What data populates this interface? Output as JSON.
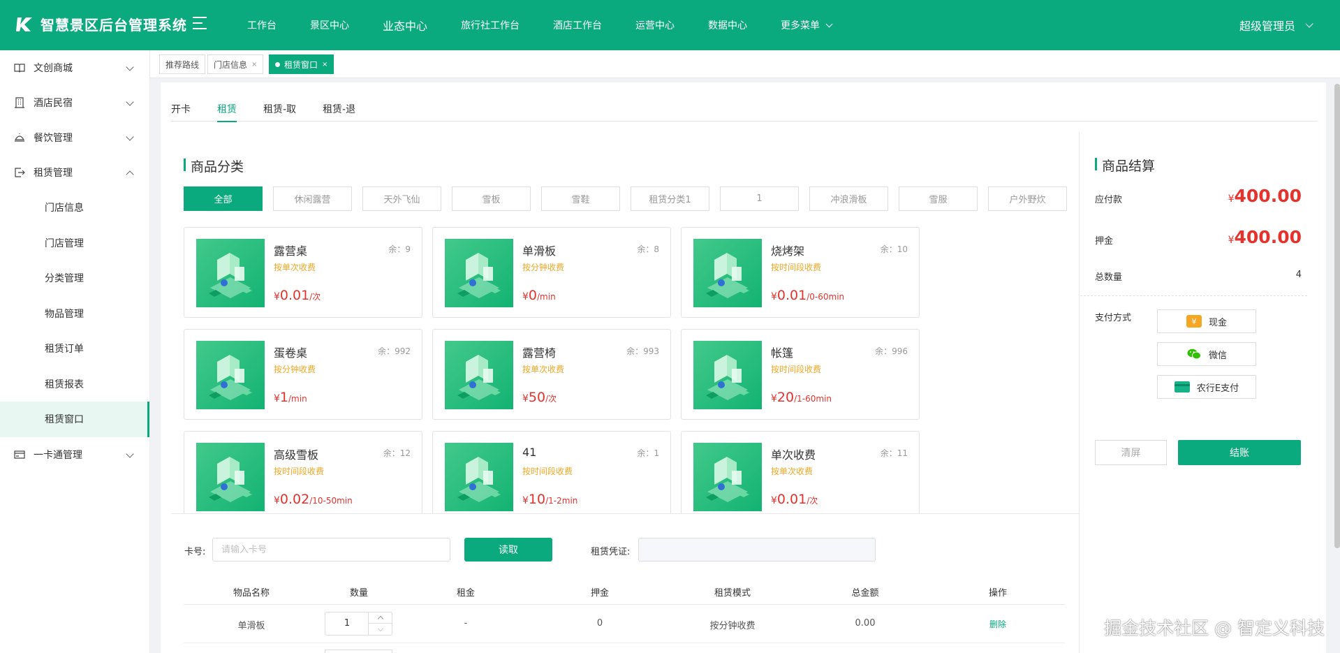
{
  "header": {
    "app_title": "智慧景区后台管理系统",
    "nav": [
      {
        "label": "工作台"
      },
      {
        "label": "景区中心"
      },
      {
        "label": "业态中心"
      },
      {
        "label": "旅行社工作台"
      },
      {
        "label": "酒店工作台"
      },
      {
        "label": "运营中心"
      },
      {
        "label": "数据中心"
      }
    ],
    "nav_more": "更多菜单",
    "user": "超级管理员",
    "brand_color": "#0aa97e"
  },
  "sidebar": {
    "groups": [
      {
        "label": "文创商城",
        "icon": "book-icon"
      },
      {
        "label": "酒店民宿",
        "icon": "building-icon"
      },
      {
        "label": "餐饮管理",
        "icon": "dining-icon"
      },
      {
        "label": "租赁管理",
        "icon": "rental-icon"
      },
      {
        "label": "一卡通管理",
        "icon": "card-icon"
      }
    ],
    "rental_items": [
      {
        "label": "门店信息"
      },
      {
        "label": "门店管理"
      },
      {
        "label": "分类管理"
      },
      {
        "label": "物品管理"
      },
      {
        "label": "租赁订单"
      },
      {
        "label": "租赁报表"
      },
      {
        "label": "租赁窗口"
      }
    ],
    "active_item": "租赁窗口"
  },
  "tags": [
    {
      "label": "推荐路线"
    },
    {
      "label": "门店信息"
    },
    {
      "label": "租赁窗口"
    }
  ],
  "close_symbol": "×",
  "subtabs": [
    {
      "label": "开卡"
    },
    {
      "label": "租赁"
    },
    {
      "label": "租赁-取"
    },
    {
      "label": "租赁-退"
    }
  ],
  "categories": {
    "title": "商品分类",
    "items": [
      "全部",
      "休闲露营",
      "天外飞仙",
      "雪板",
      "雪鞋",
      "租赁分类1",
      "1",
      "冲浪滑板",
      "雪服",
      "户外野炊"
    ],
    "active": "全部"
  },
  "goods": [
    {
      "name": "露营桌",
      "stock": "余：9",
      "mode": "按单次收费",
      "yen": "¥",
      "price": "0.01",
      "unit": "/次"
    },
    {
      "name": "单滑板",
      "stock": "余：8",
      "mode": "按分钟收费",
      "yen": "¥",
      "price": "0",
      "unit": "/min"
    },
    {
      "name": "烧烤架",
      "stock": "余：10",
      "mode": "按时间段收费",
      "yen": "¥",
      "price": "0.01",
      "unit": "/0-60min"
    },
    {
      "name": "蛋卷桌",
      "stock": "余：992",
      "mode": "按分钟收费",
      "yen": "¥",
      "price": "1",
      "unit": "/min"
    },
    {
      "name": "露营椅",
      "stock": "余：993",
      "mode": "按单次收费",
      "yen": "¥",
      "price": "50",
      "unit": "/次"
    },
    {
      "name": "帐篷",
      "stock": "余：996",
      "mode": "按时间段收费",
      "yen": "¥",
      "price": "20",
      "unit": "/1-60min"
    },
    {
      "name": "高级雪板",
      "stock": "余：12",
      "mode": "按时间段收费",
      "yen": "¥",
      "price": "0.02",
      "unit": "/10-50min"
    },
    {
      "name": "41",
      "stock": "余：1",
      "mode": "按时间段收费",
      "yen": "¥",
      "price": "10",
      "unit": "/1-2min"
    },
    {
      "name": "单次收费",
      "stock": "余：11",
      "mode": "按单次收费",
      "yen": "¥",
      "price": "0.01",
      "unit": "/次"
    }
  ],
  "form": {
    "card_label": "卡号:",
    "card_placeholder": "请输入卡号",
    "card_value": "",
    "read_button": "读取",
    "voucher_label": "租赁凭证:",
    "voucher_value": ""
  },
  "table": {
    "columns": [
      "物品名称",
      "数量",
      "租金",
      "押金",
      "租赁模式",
      "总金额",
      "操作"
    ],
    "rows": [
      {
        "name": "单滑板",
        "qty": "1",
        "rent": "-",
        "deposit": "0",
        "mode": "按分钟收费",
        "total": "0.00",
        "action": "删除"
      }
    ]
  },
  "settlement": {
    "title": "商品结算",
    "due_label": "应付款",
    "due_yen": "¥",
    "due_amount": "400.00",
    "deposit_label": "押金",
    "deposit_yen": "¥",
    "deposit_amount": "400.00",
    "count_label": "总数量",
    "count_value": "4",
    "pay_label": "支付方式",
    "pay_methods": [
      {
        "label": "现金",
        "icon": "cash-icon",
        "color": "#f5a623",
        "glyph": "¥"
      },
      {
        "label": "微信",
        "icon": "wechat-icon",
        "color": "#2dc100",
        "glyph": ""
      },
      {
        "label": "农行E支付",
        "icon": "bank-card-icon",
        "color": "#17b288",
        "glyph": ""
      }
    ],
    "clear_button": "清屏",
    "checkout_button": "结账"
  },
  "watermark": "掘金技术社区 @ 智定义科技"
}
